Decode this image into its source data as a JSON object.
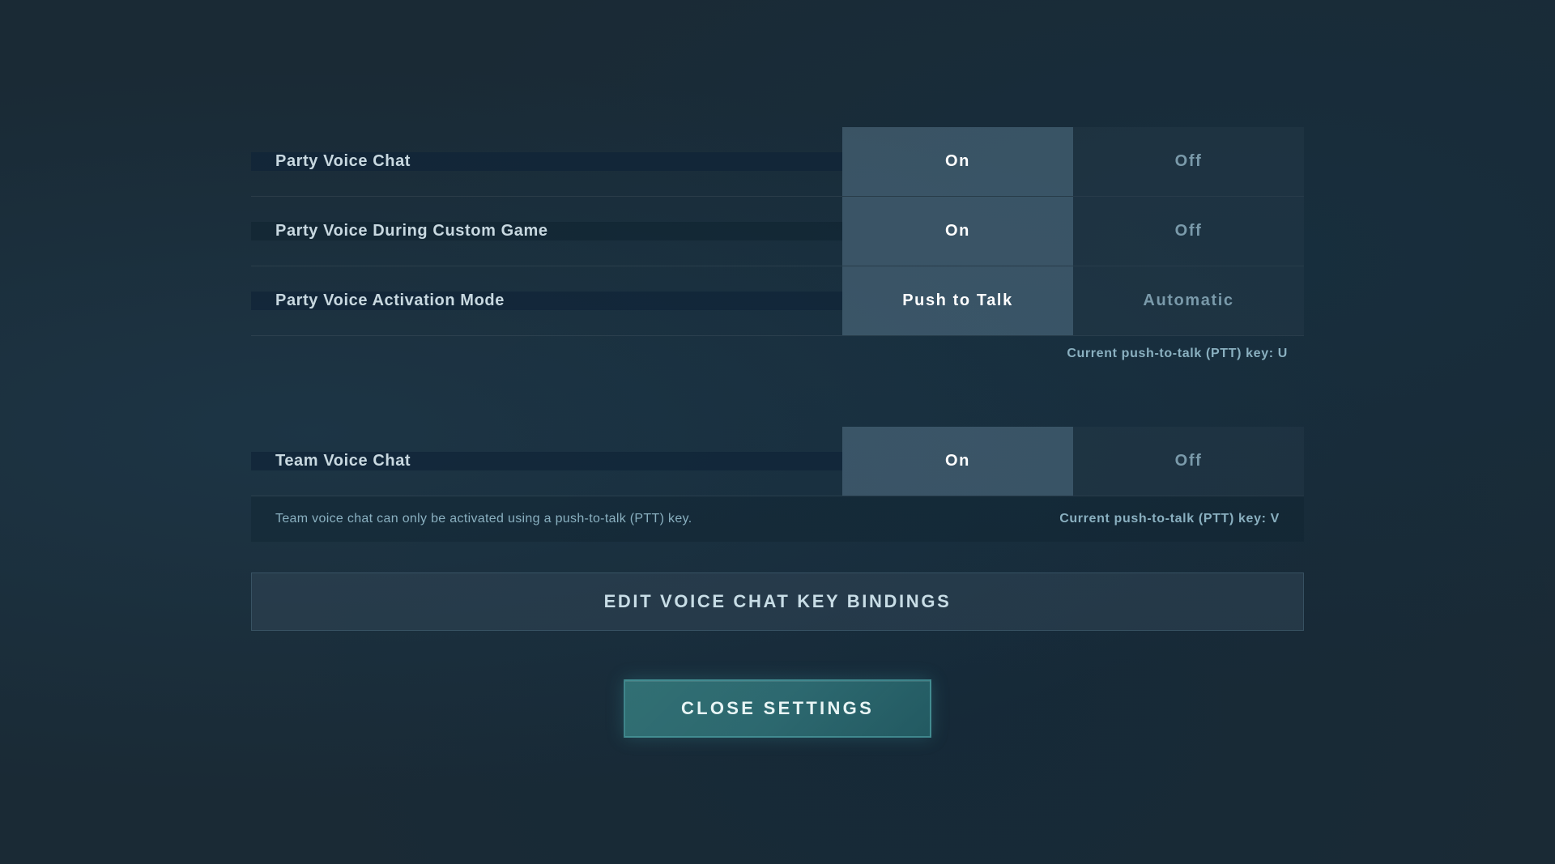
{
  "settings": {
    "party_voice_chat": {
      "label": "Party Voice Chat",
      "active": "On",
      "inactive": "Off"
    },
    "party_voice_custom": {
      "label": "Party Voice During Custom Game",
      "active": "On",
      "inactive": "Off"
    },
    "party_voice_activation": {
      "label": "Party Voice Activation Mode",
      "active": "Push to Talk",
      "inactive": "Automatic"
    },
    "ptt_note_party": "Current push-to-talk (PTT) key: U",
    "team_voice_chat": {
      "label": "Team Voice Chat",
      "active": "On",
      "inactive": "Off"
    },
    "team_voice_info": "Team voice chat can only be activated using a push-to-talk (PTT) key.",
    "ptt_note_team": "Current push-to-talk (PTT) key: V",
    "edit_bindings_label": "EDIT VOICE CHAT KEY BINDINGS",
    "close_settings_label": "CLOSE SETTINGS"
  }
}
